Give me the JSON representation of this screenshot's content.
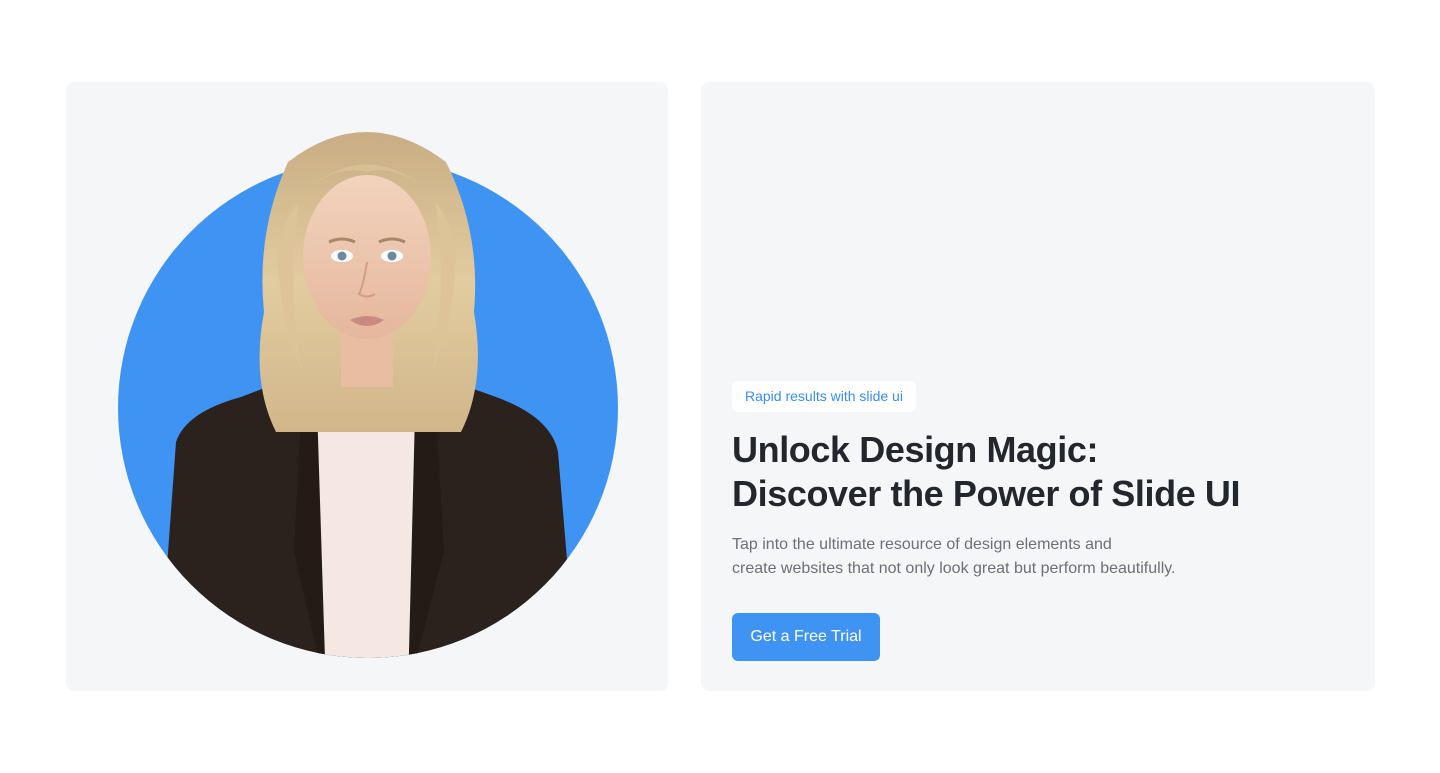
{
  "hero": {
    "badge": "Rapid results with slide ui",
    "headline_line1": "Unlock Design Magic:",
    "headline_line2": "Discover the Power of Slide UI",
    "description_line1": "Tap into the ultimate resource of design elements and",
    "description_line2": "create websites that not only look great but perform beautifully.",
    "cta_label": "Get a Free Trial"
  },
  "colors": {
    "accent": "#3F93F3",
    "card_background": "#F5F6F8",
    "heading": "#23262D",
    "body_text": "#6B6F78"
  }
}
